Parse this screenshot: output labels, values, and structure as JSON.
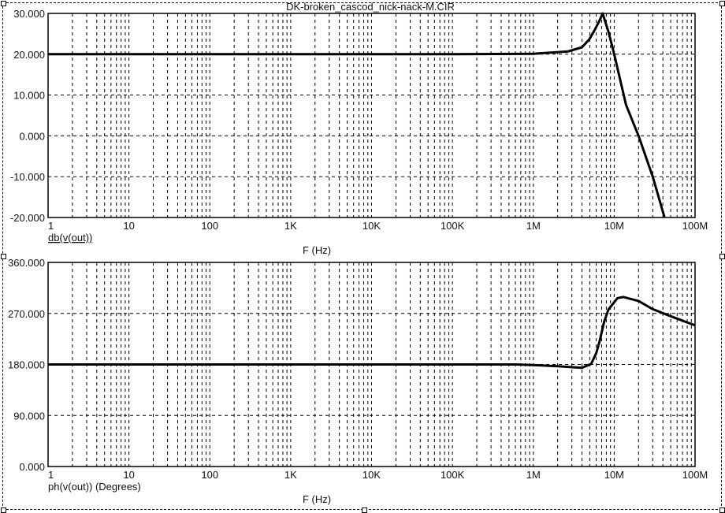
{
  "chart_data": [
    {
      "type": "line",
      "title": "DK-broken_cascod_nick-nack-M.CIR",
      "xlabel": "F (Hz)",
      "trace_label": "db(v(out))",
      "xscale": "log",
      "xlim": [
        1,
        100000000
      ],
      "ylim": [
        -20,
        30
      ],
      "x_tick_labels": [
        "1",
        "10",
        "100",
        "1K",
        "10K",
        "100K",
        "1M",
        "10M",
        "100M"
      ],
      "y_ticks": [
        30,
        20,
        10,
        0,
        -10,
        -20
      ],
      "y_tick_labels": [
        "30.000",
        "20.000",
        "10.000",
        "0.000",
        "-10.000",
        "-20.000"
      ],
      "grid": true,
      "series": [
        {
          "name": "db(v(out))",
          "color": "#000000",
          "x": [
            1,
            100,
            10000,
            100000,
            1000000,
            2700000,
            4000000,
            4900000,
            5800000,
            6600000,
            7200000,
            8500000,
            10000000,
            14000000,
            20000000,
            30000000,
            42000000
          ],
          "y": [
            20,
            20,
            20,
            20,
            20.1,
            20.7,
            21.7,
            23.6,
            26.1,
            28.3,
            30,
            25.5,
            20,
            7.6,
            0,
            -10,
            -20
          ]
        }
      ]
    },
    {
      "type": "line",
      "xlabel": "F (Hz)",
      "trace_label": "ph(v(out)) (Degrees)",
      "xscale": "log",
      "xlim": [
        1,
        100000000
      ],
      "ylim": [
        0,
        360
      ],
      "x_tick_labels": [
        "1",
        "10",
        "100",
        "1K",
        "10K",
        "100K",
        "1M",
        "10M",
        "100M"
      ],
      "y_ticks": [
        360,
        270,
        180,
        90,
        0
      ],
      "y_tick_labels": [
        "360.000",
        "270.000",
        "180.000",
        "90.000",
        "0.000"
      ],
      "grid": true,
      "series": [
        {
          "name": "ph(v(out))",
          "color": "#000000",
          "x": [
            1,
            100,
            10000,
            100000,
            600000,
            1000000,
            2000000,
            4000000,
            5200000,
            6000000,
            6600000,
            7500000,
            8500000,
            11000000,
            13000000,
            20000000,
            29500000,
            50000000,
            100000000
          ],
          "y": [
            180,
            180,
            180,
            180,
            180,
            179,
            177,
            174,
            181,
            200,
            221,
            255,
            277,
            297,
            299,
            292,
            278,
            265,
            249
          ]
        }
      ]
    }
  ]
}
